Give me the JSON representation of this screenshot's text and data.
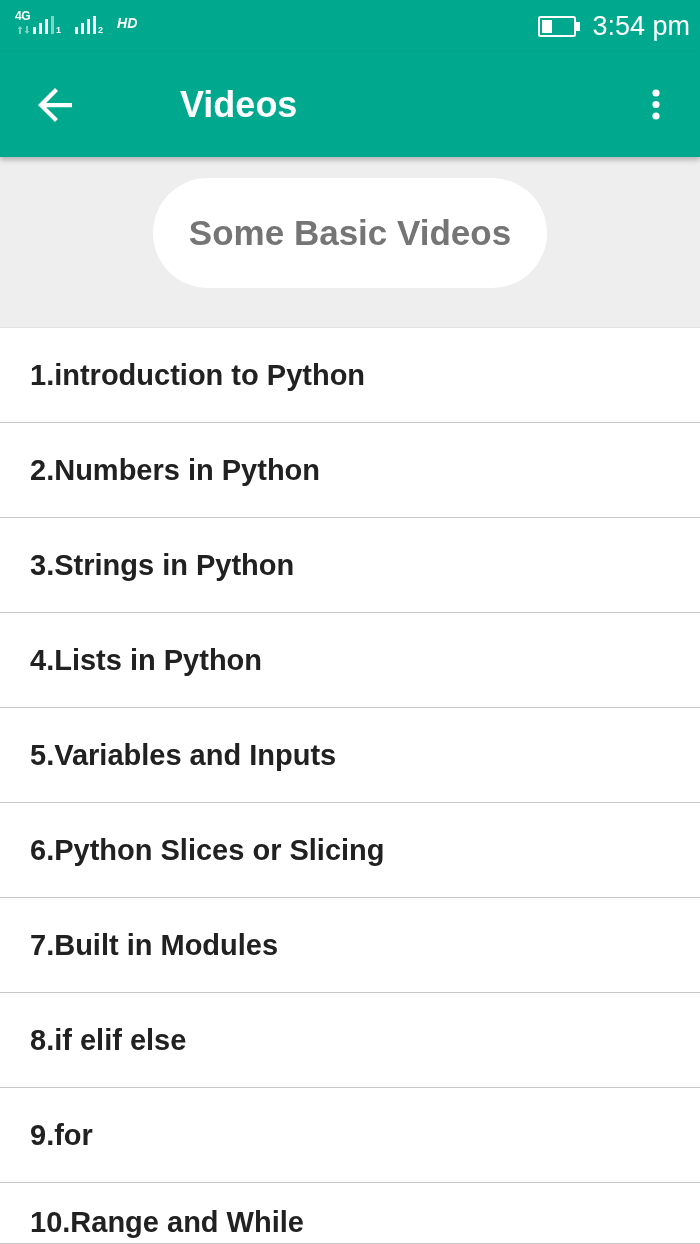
{
  "status_bar": {
    "network": "4G",
    "sim_1_label": "1",
    "sim_2_label": "2",
    "hd_label": "HD",
    "time": "3:54 pm"
  },
  "app_bar": {
    "title": "Videos"
  },
  "section_header": {
    "title": "Some Basic Videos"
  },
  "videos": [
    "1.introduction to Python",
    "2.Numbers in Python",
    "3.Strings in Python",
    "4.Lists in Python",
    "5.Variables and Inputs",
    "6.Python Slices or Slicing",
    "7.Built in Modules",
    "8.if elif else",
    "9.for",
    "10.Range and While"
  ]
}
